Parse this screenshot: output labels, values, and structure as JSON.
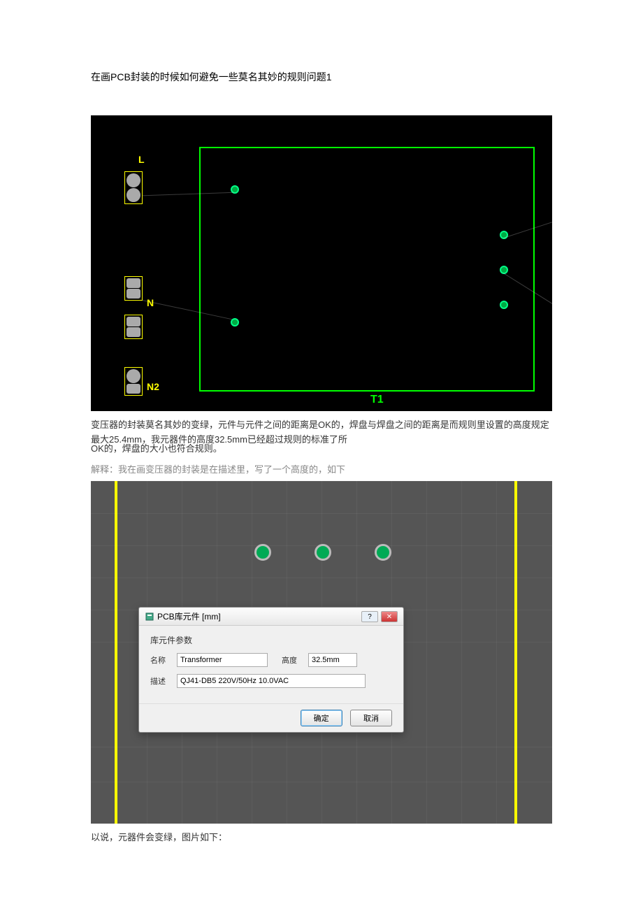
{
  "title": "在画PCB封装的时候如何避免一些莫名其妙的规则问题1",
  "pcb1": {
    "L_label": "L",
    "N_label": "N",
    "N2_label": "N2",
    "T1_label": "T1"
  },
  "body1": "变压器的封装莫名其妙的变绿，元件与元件之间的距离是OK的，焊盘与焊盘之间的距离是而规则里设置的高度规定最大25.4mm，我元器件的高度32.5mm已经超过规则的标准了所",
  "body1b": "OK的，焊盘的大小也符合规则。",
  "body2": "解释：我在画变压器的封装是在描述里，写了一个高度的，如下",
  "dialog": {
    "title": "PCB库元件 [mm]",
    "section": "库元件参数",
    "name_label": "名称",
    "name_value": "Transformer",
    "height_label": "高度",
    "height_value": "32.5mm",
    "desc_label": "描述",
    "desc_value": "QJ41-DB5 220V/50Hz 10.0VAC",
    "ok": "确定",
    "cancel": "取消"
  },
  "body3": "以说，元器件会变绿，图片如下："
}
